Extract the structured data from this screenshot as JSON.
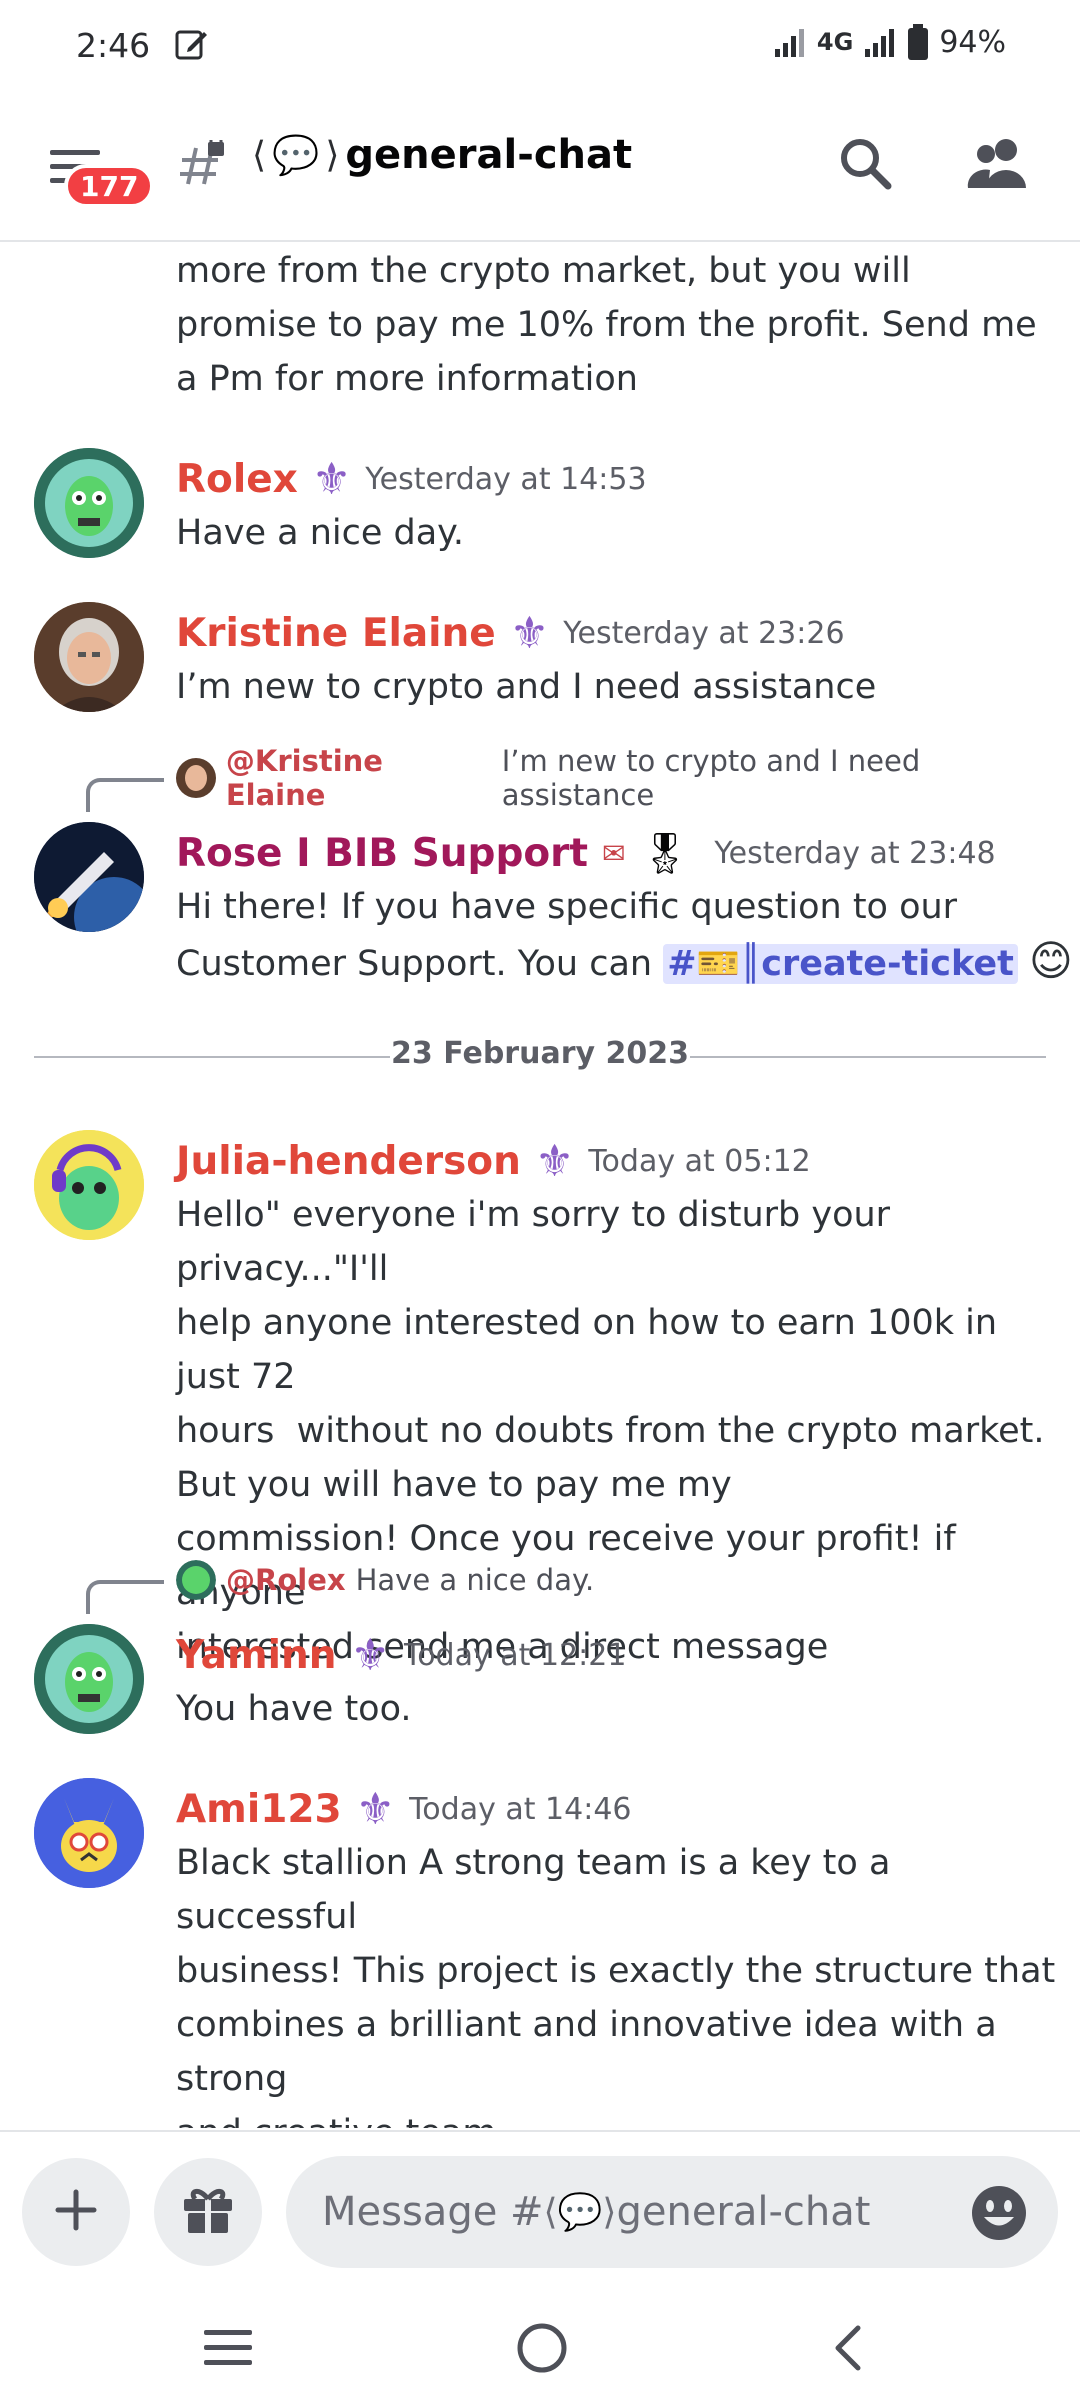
{
  "status_bar": {
    "time": "2:46",
    "network": "4G",
    "battery": "94%"
  },
  "header": {
    "unread_badge": "177",
    "channel_name": "general-chat",
    "channel_emoji": "💬"
  },
  "messages": [
    {
      "id": "m0",
      "continuation_text": "more from the crypto market, but you will promise to pay me 10% from the profit. Send me a Pm for more information"
    },
    {
      "id": "m1",
      "author": "Rolex",
      "author_color": "#e0473a",
      "timestamp": "Yesterday at 14:53",
      "text": "Have a nice day."
    },
    {
      "id": "m2",
      "author": "Kristine Elaine",
      "author_color": "#e0473a",
      "timestamp": "Yesterday at 23:26",
      "text": "I’m new to crypto and I need assistance"
    },
    {
      "id": "m3",
      "reply_to_author": "@Kristine Elaine",
      "reply_to_text": "I’m new to crypto and I need assistance",
      "author": "Rose I BIB Support",
      "author_color": "#a1185a",
      "timestamp": "Yesterday at 23:48",
      "text_line1": "Hi there! If you have specific question to our",
      "text_line2_prefix": "Customer Support. You can",
      "channel_mention": "#🎫║create-ticket",
      "trailing_emoji": "😊"
    },
    {
      "id": "m4",
      "author": "Julia-henderson",
      "author_color": "#e0473a",
      "timestamp": "Today at 05:12",
      "text_lines": [
        "Hello\" everyone i'm sorry to disturb your privacy...\"I'll",
        "help anyone interested on how to earn 100k in just 72",
        "hours  without no doubts from the crypto market.",
        "But you will have to pay me my",
        "commission! Once you receive your profit! if anyone",
        "interested send me a direct message"
      ]
    },
    {
      "id": "m5",
      "reply_to_author": "@Rolex",
      "reply_to_text": "Have a nice day.",
      "author": "Yaminn",
      "author_color": "#e0473a",
      "timestamp": "Today at 12:21",
      "text": "You have too."
    },
    {
      "id": "m6",
      "author": "Ami123",
      "author_color": "#e0473a",
      "timestamp": "Today at 14:46",
      "text_lines": [
        "Black stallion A strong team is a key to a successful",
        "business! This project is exactly the structure that",
        "combines a brilliant and innovative idea with a strong",
        "and creative team"
      ]
    }
  ],
  "date_divider": "23 February 2023",
  "composer": {
    "placeholder_prefix": "Message #",
    "placeholder_channel": "general-chat"
  },
  "icons": {
    "role": "fleur-de-lis-icon",
    "search": "search-icon",
    "members": "members-icon",
    "add": "plus-icon",
    "gift": "gift-icon",
    "emoji": "emoji-icon"
  }
}
